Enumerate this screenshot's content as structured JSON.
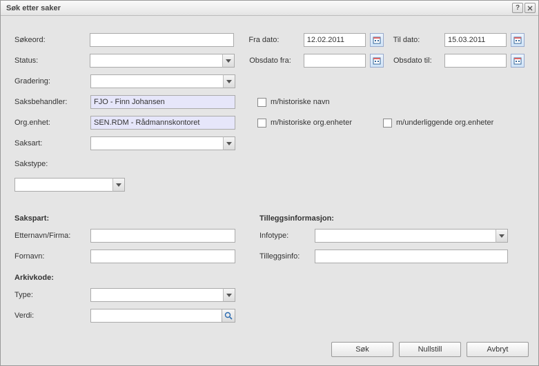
{
  "window": {
    "title": "Søk etter saker"
  },
  "labels": {
    "sokeord": "Søkeord:",
    "status": "Status:",
    "gradering": "Gradering:",
    "saksbehandler": "Saksbehandler:",
    "orgenhet": "Org.enhet:",
    "saksart": "Saksart:",
    "sakstype": "Sakstype:",
    "fradato": "Fra dato:",
    "tildato": "Til dato:",
    "obsdato_fra": "Obsdato fra:",
    "obsdato_til": "Obsdato til:",
    "m_historiske_navn": "m/historiske navn",
    "m_historiske_orgenheter": "m/historiske org.enheter",
    "m_underliggende_orgenheter": "m/underliggende org.enheter",
    "sakspart": "Sakspart:",
    "etternavn_firma": "Etternavn/Firma:",
    "fornavn": "Fornavn:",
    "arkivkode": "Arkivkode:",
    "type": "Type:",
    "verdi": "Verdi:",
    "tilleggsinfo_header": "Tilleggsinformasjon:",
    "infotype": "Infotype:",
    "tilleggsinfo": "Tilleggsinfo:"
  },
  "values": {
    "sokeord": "",
    "status": "",
    "gradering": "",
    "saksbehandler": "FJO - Finn Johansen",
    "orgenhet": "SEN.RDM - Rådmannskontoret",
    "saksart": "",
    "sakstype": "",
    "fradato": "12.02.2011",
    "tildato": "15.03.2011",
    "obsdato_fra": "",
    "obsdato_til": "",
    "etternavn_firma": "",
    "fornavn": "",
    "type": "",
    "verdi": "",
    "infotype": "",
    "tilleggsinfo": ""
  },
  "buttons": {
    "sok": "Søk",
    "nullstill": "Nullstill",
    "avbryt": "Avbryt"
  }
}
